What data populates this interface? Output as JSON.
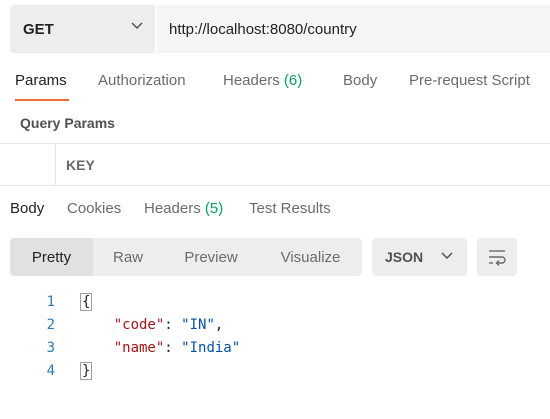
{
  "request": {
    "method": "GET",
    "url": "http://localhost:8080/country"
  },
  "request_tabs": {
    "params": "Params",
    "authorization": "Authorization",
    "headers": "Headers",
    "headers_count": "(6)",
    "body": "Body",
    "prerequest": "Pre-request Script"
  },
  "params_section": {
    "title": "Query Params",
    "key_header": "KEY"
  },
  "response_tabs": {
    "body": "Body",
    "cookies": "Cookies",
    "headers": "Headers",
    "headers_count": "(5)",
    "test_results": "Test Results"
  },
  "view_modes": {
    "pretty": "Pretty",
    "raw": "Raw",
    "preview": "Preview",
    "visualize": "Visualize"
  },
  "format": "JSON",
  "code": {
    "line_numbers": [
      "1",
      "2",
      "3",
      "4"
    ],
    "open_brace": "{",
    "close_brace": "}",
    "key1": "\"code\"",
    "val1": "\"IN\"",
    "key2": "\"name\"",
    "val2": "\"India\""
  },
  "colors": {
    "accent": "#f26b3a",
    "count_green": "#0b9e60",
    "json_key": "#a21515",
    "json_string": "#0451a5",
    "line_number": "#2f7bb0"
  }
}
